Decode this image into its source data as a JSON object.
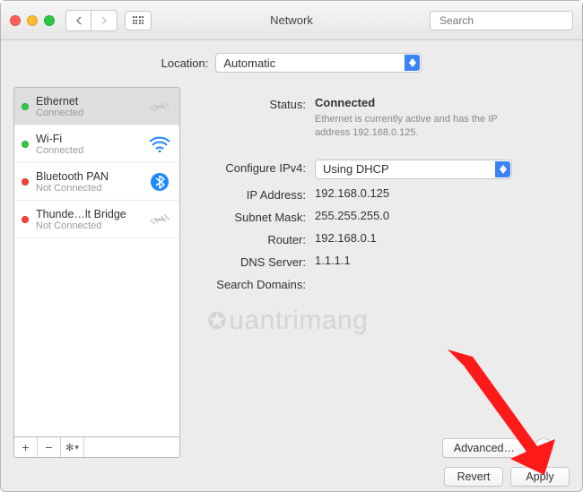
{
  "window": {
    "title": "Network"
  },
  "search": {
    "placeholder": "Search"
  },
  "location": {
    "label": "Location:",
    "value": "Automatic"
  },
  "sidebar": {
    "items": [
      {
        "name": "Ethernet",
        "status": "Connected",
        "dot": "green",
        "icon": "ethernet",
        "selected": true,
        "iconcolor": "dim"
      },
      {
        "name": "Wi-Fi",
        "status": "Connected",
        "dot": "green",
        "icon": "wifi"
      },
      {
        "name": "Bluetooth PAN",
        "status": "Not Connected",
        "dot": "red",
        "icon": "bluetooth"
      },
      {
        "name": "Thunde…lt Bridge",
        "status": "Not Connected",
        "dot": "red",
        "icon": "ethernet",
        "iconcolor": "dim"
      }
    ],
    "buttons": {
      "add": "+",
      "remove": "−",
      "gear": "✻▾"
    }
  },
  "details": {
    "status_label": "Status:",
    "status_value": "Connected",
    "status_sub": "Ethernet is currently active and has the IP address 192.168.0.125.",
    "configure_label": "Configure IPv4:",
    "configure_value": "Using DHCP",
    "fields": {
      "ip_label": "IP Address:",
      "ip_value": "192.168.0.125",
      "subnet_label": "Subnet Mask:",
      "subnet_value": "255.255.255.0",
      "router_label": "Router:",
      "router_value": "192.168.0.1",
      "dns_label": "DNS Server:",
      "dns_value": "1.1.1.1",
      "search_label": "Search Domains:",
      "search_value": ""
    },
    "buttons": {
      "advanced": "Advanced…",
      "help": "?",
      "revert": "Revert",
      "apply": "Apply"
    }
  },
  "watermark": "uantrimang"
}
